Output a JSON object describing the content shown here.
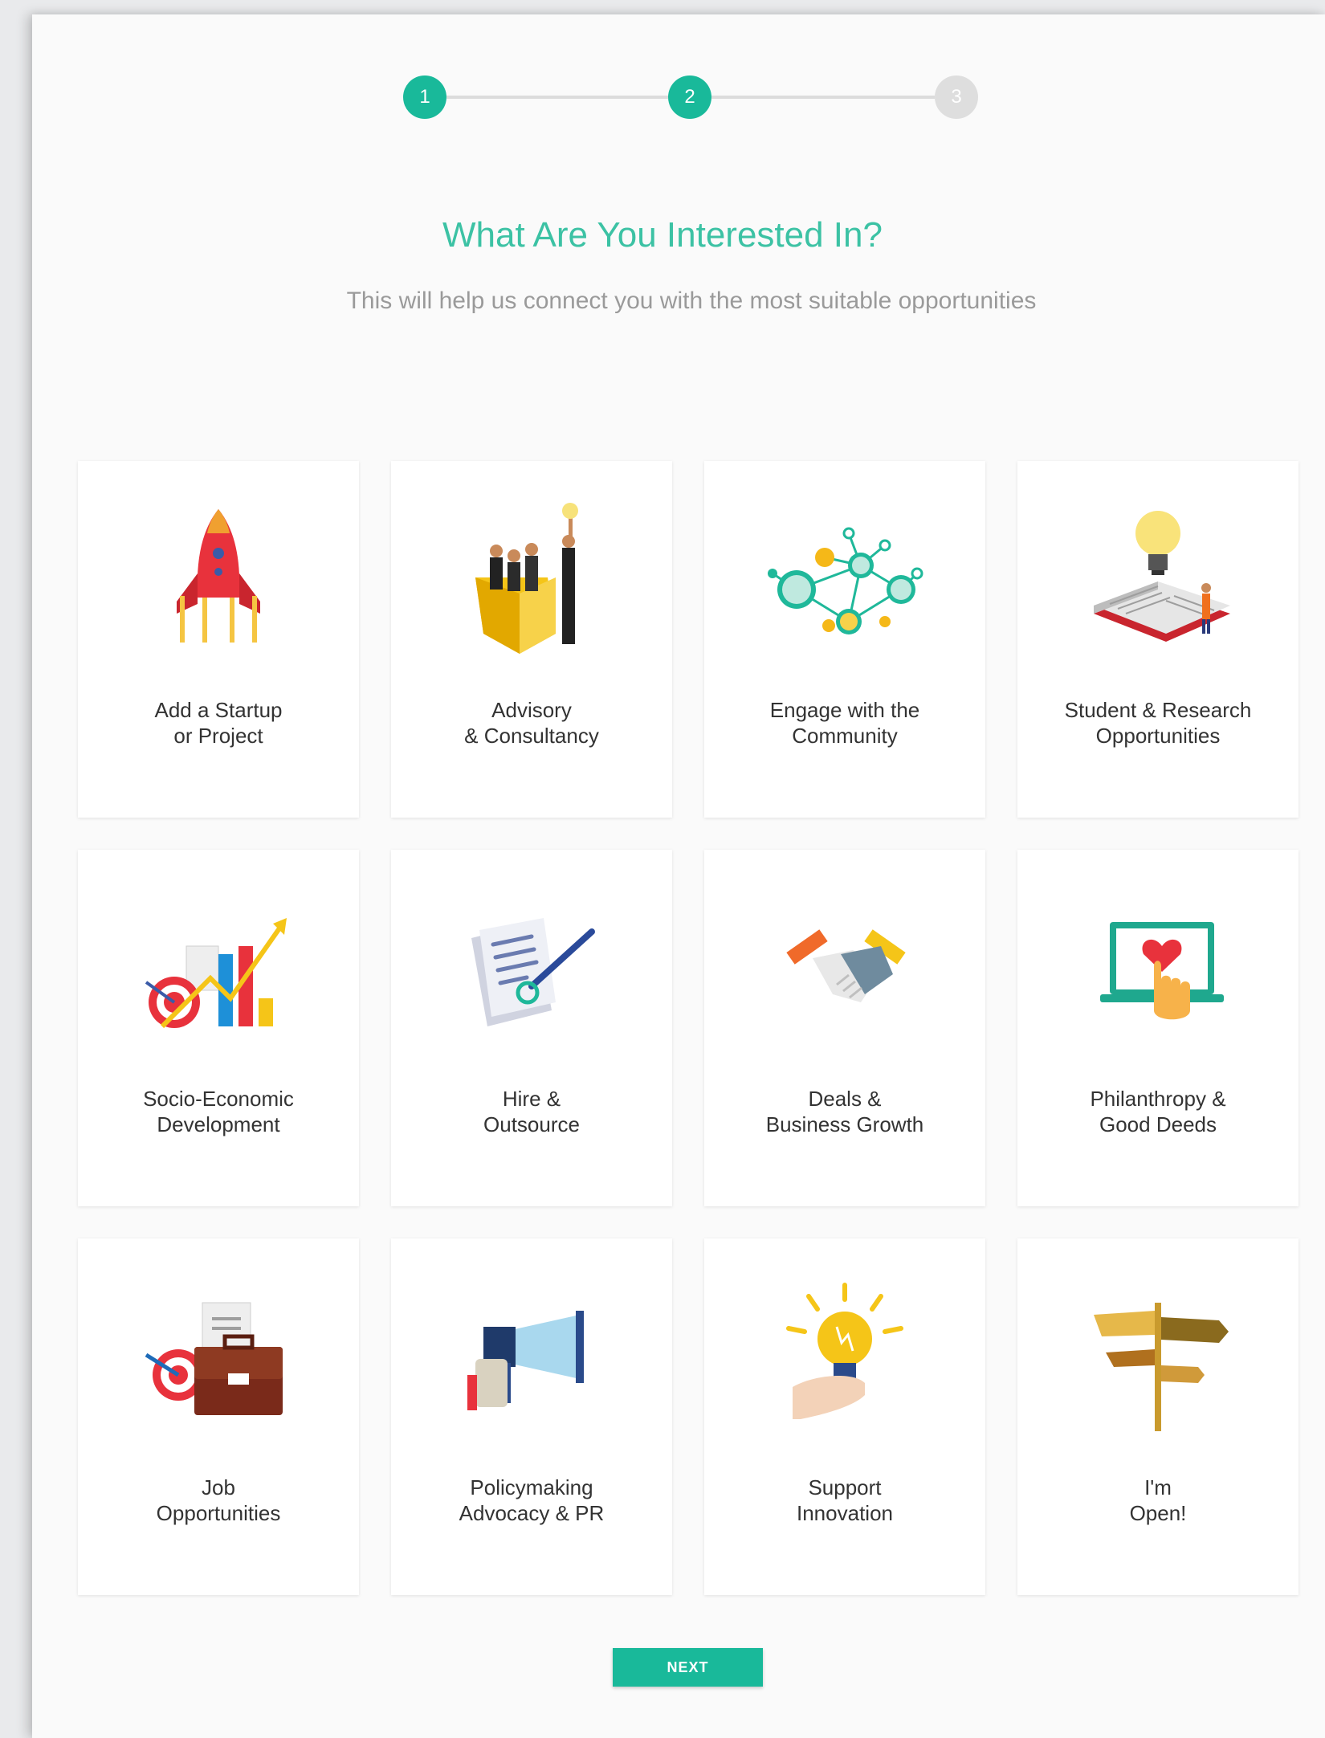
{
  "stepper": {
    "steps": [
      {
        "number": "1",
        "state": "complete"
      },
      {
        "number": "2",
        "state": "active"
      },
      {
        "number": "3",
        "state": "inactive"
      }
    ]
  },
  "header": {
    "title": "What Are You Interested In?",
    "subtitle": "This will help us connect you with the most suitable opportunities"
  },
  "cards": [
    {
      "label": "Add a Startup\nor Project",
      "icon": "rocket-icon"
    },
    {
      "label": "Advisory\n& Consultancy",
      "icon": "business-team-box-icon"
    },
    {
      "label": "Engage with the\nCommunity",
      "icon": "network-icon"
    },
    {
      "label": "Student & Research\nOpportunities",
      "icon": "book-lightbulb-icon"
    },
    {
      "label": "Socio-Economic\nDevelopment",
      "icon": "growth-chart-icon"
    },
    {
      "label": "Hire &\nOutsource",
      "icon": "contract-pen-icon"
    },
    {
      "label": "Deals &\nBusiness Growth",
      "icon": "handshake-icon"
    },
    {
      "label": "Philanthropy &\nGood Deeds",
      "icon": "laptop-heart-icon"
    },
    {
      "label": "Job\nOpportunities",
      "icon": "briefcase-target-icon"
    },
    {
      "label": "Policymaking\nAdvocacy & PR",
      "icon": "megaphone-icon"
    },
    {
      "label": "Support\nInnovation",
      "icon": "hand-lightbulb-icon"
    },
    {
      "label": "I'm\nOpen!",
      "icon": "signpost-icon"
    }
  ],
  "footer": {
    "next_label": "NEXT"
  },
  "colors": {
    "accent": "#19b99a",
    "title": "#3cc2a4",
    "inactive_step": "#dedede"
  }
}
